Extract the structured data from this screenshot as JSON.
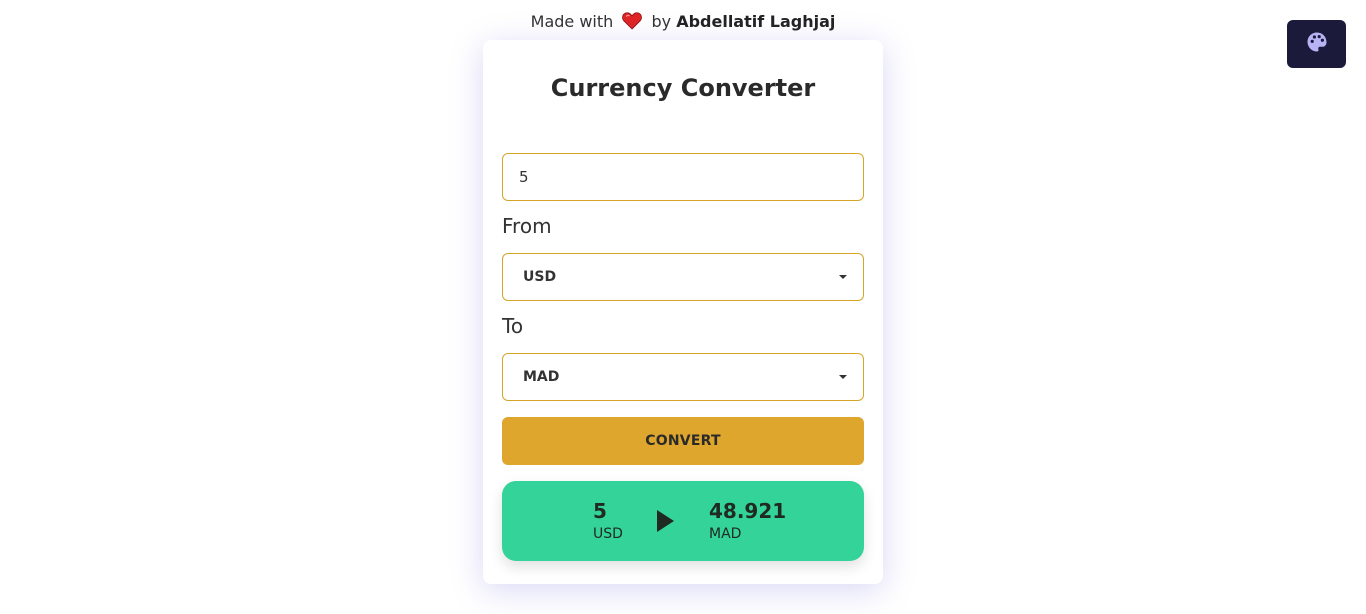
{
  "credit": {
    "prefix": "Made with",
    "heart_icon": "heart-icon",
    "by": "by",
    "author": "Abdellatif Laghjaj"
  },
  "theme_toggle": {
    "icon": "palette-icon",
    "bg_color": "#1b1a3a",
    "icon_color": "#b8b3f5"
  },
  "converter": {
    "title": "Currency Converter",
    "amount_value": "5",
    "from_label": "From",
    "from_value": "USD",
    "to_label": "To",
    "to_value": "MAD",
    "convert_label": "CONVERT"
  },
  "result": {
    "from_amount": "5",
    "from_currency": "USD",
    "arrow_icon": "play-arrow-icon",
    "to_amount": "48.921",
    "to_currency": "MAD"
  },
  "colors": {
    "accent": "#dea62d",
    "result_bg": "#34d399",
    "border": "#d4a52a"
  }
}
